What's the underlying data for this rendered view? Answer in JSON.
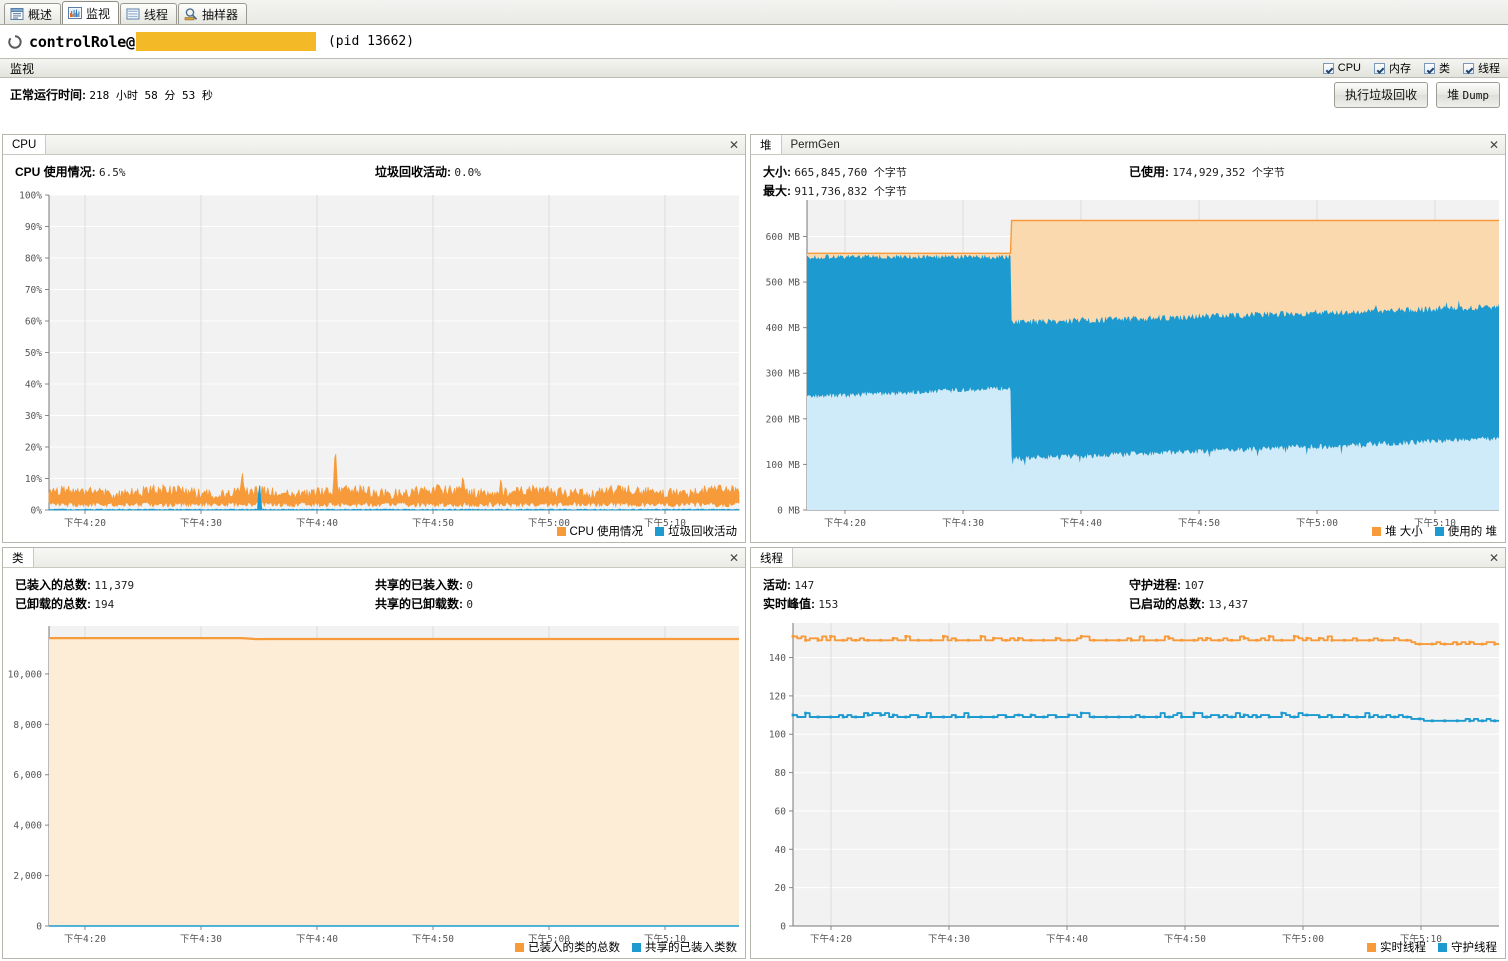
{
  "tabs": [
    {
      "label": "概述",
      "icon": "overview-icon",
      "active": false
    },
    {
      "label": "监视",
      "icon": "monitor-icon",
      "active": true
    },
    {
      "label": "线程",
      "icon": "threads-icon",
      "active": false
    },
    {
      "label": "抽样器",
      "icon": "sampler-icon",
      "active": false
    }
  ],
  "header": {
    "spinner_icon": "loading-spinner-icon",
    "process_name": "controlRole@",
    "redacted_host": "",
    "pid_text": "(pid 13662)"
  },
  "sectionbar": {
    "label": "监视",
    "checkboxes": [
      {
        "label": "CPU",
        "checked": true
      },
      {
        "label": "内存",
        "checked": true
      },
      {
        "label": "类",
        "checked": true
      },
      {
        "label": "线程",
        "checked": true
      }
    ]
  },
  "uptime": {
    "label": "正常运行时间:",
    "value": "218 小时 58 分 53 秒"
  },
  "buttons": {
    "gc": "执行垃圾回收",
    "heap_dump_prefix": "堆 ",
    "heap_dump_mono": "Dump"
  },
  "colors": {
    "orange": "#f79a3a",
    "orange_fill": "#fad9ae",
    "blue": "#1d9bd1",
    "blue_fill": "#cfeaf8",
    "plot_bg": "#f2f2f2",
    "grid": "#ffffff",
    "accent_redact": "#f3b927"
  },
  "panels": {
    "cpu": {
      "title": "CPU",
      "close_icon": "close-icon",
      "stats": [
        {
          "label": "CPU 使用情况:",
          "value": "6.5%"
        },
        {
          "label": "垃圾回收活动:",
          "value": "0.0%"
        }
      ],
      "legend": [
        {
          "label": "CPU 使用情况",
          "color": "#f79a3a"
        },
        {
          "label": "垃圾回收活动",
          "color": "#1d9bd1"
        }
      ]
    },
    "heap": {
      "tab_active": "堆",
      "tab_inactive": "PermGen",
      "close_icon": "close-icon",
      "stats": [
        {
          "label": "大小:",
          "value": "665,845,760 个字节"
        },
        {
          "label": "最大:",
          "value": "911,736,832 个字节"
        },
        {
          "label": "已使用:",
          "value": "174,929,352 个字节"
        }
      ],
      "legend": [
        {
          "label": "堆 大小",
          "color": "#f79a3a"
        },
        {
          "label": "使用的 堆",
          "color": "#1d9bd1"
        }
      ]
    },
    "classes": {
      "title": "类",
      "close_icon": "close-icon",
      "stats": [
        {
          "label": "已装入的总数:",
          "value": "11,379"
        },
        {
          "label": "已卸载的总数:",
          "value": "194"
        },
        {
          "label": "共享的已装入数:",
          "value": "0"
        },
        {
          "label": "共享的已卸载数:",
          "value": "0"
        }
      ],
      "legend": [
        {
          "label": "已装入的类的总数",
          "color": "#f79a3a"
        },
        {
          "label": "共享的已装入类数",
          "color": "#1d9bd1"
        }
      ]
    },
    "threads": {
      "title": "线程",
      "close_icon": "close-icon",
      "stats": [
        {
          "label": "活动:",
          "value": "147"
        },
        {
          "label": "实时峰值:",
          "value": "153"
        },
        {
          "label": "守护进程:",
          "value": "107"
        },
        {
          "label": "已启动的总数:",
          "value": "13,437"
        }
      ],
      "legend": [
        {
          "label": "实时线程",
          "color": "#f79a3a"
        },
        {
          "label": "守护线程",
          "color": "#1d9bd1"
        }
      ]
    }
  },
  "chart_data": [
    {
      "id": "cpu",
      "type": "area",
      "title": "CPU",
      "xlabel": "",
      "ylabel": "",
      "ylim": [
        0,
        100
      ],
      "yticks": [
        "0%",
        "10%",
        "20%",
        "30%",
        "40%",
        "50%",
        "60%",
        "70%",
        "80%",
        "90%",
        "100%"
      ],
      "ytick_values": [
        0,
        10,
        20,
        30,
        40,
        50,
        60,
        70,
        80,
        90,
        100
      ],
      "xticks": [
        "下午4:20",
        "下午4:30",
        "下午4:40",
        "下午4:50",
        "下午5:00",
        "下午5:10"
      ],
      "grid": true,
      "legend_position": "bottom-right",
      "series": [
        {
          "name": "CPU 使用情况",
          "color": "#f79a3a",
          "mean": 5.5,
          "min": 2.0,
          "max": 9.5,
          "spikes": [
            {
              "x": 0.28,
              "y": 13.0
            },
            {
              "x": 0.415,
              "y": 21.0
            },
            {
              "x": 0.6,
              "y": 12.0
            },
            {
              "x": 0.655,
              "y": 11.0
            }
          ]
        },
        {
          "name": "垃圾回收活动",
          "color": "#1d9bd1",
          "mean": 0.0,
          "min": 0.0,
          "max": 0.4,
          "spikes": [
            {
              "x": 0.305,
              "y": 9.5
            }
          ]
        }
      ]
    },
    {
      "id": "heap",
      "type": "area",
      "title": "堆",
      "xlabel": "",
      "ylabel": "",
      "ylim": [
        0,
        680
      ],
      "yticks": [
        "0 MB",
        "100 MB",
        "200 MB",
        "300 MB",
        "400 MB",
        "500 MB",
        "600 MB"
      ],
      "ytick_values": [
        0,
        100,
        200,
        300,
        400,
        500,
        600
      ],
      "xticks": [
        "下午4:20",
        "下午4:30",
        "下午4:40",
        "下午4:50",
        "下午5:00",
        "下午5:10"
      ],
      "grid": true,
      "legend_position": "bottom-right",
      "series": [
        {
          "name": "堆 大小",
          "color": "#f79a3a",
          "units": "MB",
          "segments": [
            {
              "from_x": 0.0,
              "to_x": 0.295,
              "value": 563
            },
            {
              "from_x": 0.295,
              "to_x": 1.0,
              "value": 635
            }
          ]
        },
        {
          "name": "使用的 堆",
          "color": "#1d9bd1",
          "units": "MB",
          "segments": [
            {
              "from_x": 0.0,
              "to_x": 0.295,
              "low": 248,
              "high": 556,
              "trend_low": 268
            },
            {
              "from_x": 0.295,
              "to_x": 1.0,
              "low": 110,
              "high": 410,
              "trend_low": 155,
              "trend_high": 445
            }
          ]
        }
      ]
    },
    {
      "id": "classes",
      "type": "line",
      "title": "类",
      "xlabel": "",
      "ylabel": "",
      "ylim": [
        0,
        11900
      ],
      "yticks": [
        "0",
        "2,000",
        "4,000",
        "6,000",
        "8,000",
        "10,000"
      ],
      "ytick_values": [
        0,
        2000,
        4000,
        6000,
        8000,
        10000
      ],
      "xticks": [
        "下午4:20",
        "下午4:30",
        "下午4:40",
        "下午4:50",
        "下午5:00",
        "下午5:10"
      ],
      "grid": true,
      "legend_position": "bottom-right",
      "series": [
        {
          "name": "已装入的类的总数",
          "color": "#f79a3a",
          "points": [
            [
              0.0,
              11420
            ],
            [
              0.28,
              11420
            ],
            [
              0.3,
              11379
            ],
            [
              0.32,
              11385
            ],
            [
              1.0,
              11385
            ]
          ]
        },
        {
          "name": "共享的已装入类数",
          "color": "#1d9bd1",
          "points": [
            [
              0.0,
              0
            ],
            [
              1.0,
              0
            ]
          ]
        }
      ]
    },
    {
      "id": "threads",
      "type": "line",
      "title": "线程",
      "xlabel": "",
      "ylabel": "",
      "ylim": [
        0,
        158
      ],
      "yticks": [
        "0",
        "20",
        "40",
        "60",
        "80",
        "100",
        "120",
        "140"
      ],
      "ytick_values": [
        0,
        20,
        40,
        60,
        80,
        100,
        120,
        140
      ],
      "xticks": [
        "下午4:20",
        "下午4:30",
        "下午4:40",
        "下午4:50",
        "下午5:00",
        "下午5:10"
      ],
      "grid": true,
      "legend_position": "bottom-right",
      "series": [
        {
          "name": "实时线程",
          "color": "#f79a3a",
          "baseline": 149,
          "jitter": 2.0,
          "drop_x": 0.875,
          "drop_to": 147
        },
        {
          "name": "守护线程",
          "color": "#1d9bd1",
          "baseline": 109,
          "jitter": 2.0,
          "drop_x": 0.875,
          "drop_to": 107
        }
      ]
    }
  ]
}
